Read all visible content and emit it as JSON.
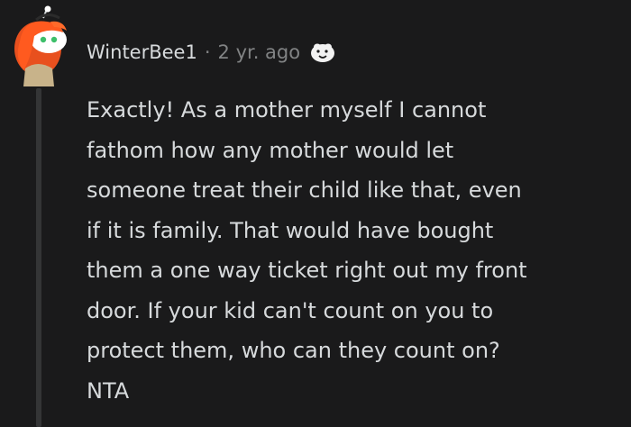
{
  "comment": {
    "author": "WinterBee1",
    "separator": "·",
    "timestamp": "2 yr. ago",
    "award_icon": "wholesome-award-icon",
    "avatar_icon": "red-hair-avatar-icon",
    "body_lines": [
      "Exactly! As a mother myself I cannot",
      "fathom how any mother would let",
      "someone treat their child like that, even",
      "if it is family. That would have bought",
      "them a one way ticket right out my front",
      "door. If your kid can't count on you to",
      "protect them, who can they count on?",
      "NTA"
    ]
  },
  "colors": {
    "background": "#1a1a1b",
    "text": "#d7dadc",
    "meta": "#818384",
    "thread_line": "#343536"
  }
}
